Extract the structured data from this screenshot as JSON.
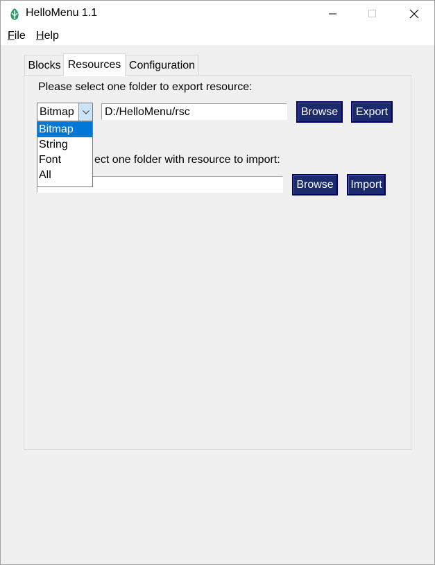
{
  "window": {
    "title": "HelloMenu 1.1",
    "icon": "app-leaf-icon",
    "controls": [
      "minimize-icon",
      "maximize-icon",
      "close-icon"
    ]
  },
  "menubar": {
    "file": {
      "accel": "F",
      "rest": "ile"
    },
    "help": {
      "accel": "H",
      "rest": "elp"
    }
  },
  "tabs": [
    {
      "label": "Blocks",
      "active": false
    },
    {
      "label": "Resources",
      "active": true
    },
    {
      "label": "Configuration",
      "active": false
    }
  ],
  "export": {
    "prompt": "Please select one folder to export resource:",
    "type_selected": "Bitmap",
    "path": "D:/HelloMenu/rsc",
    "browse_label": "Browse",
    "export_label": "Export"
  },
  "import": {
    "prompt_visible": "ect one folder with resource to import:",
    "path": "",
    "browse_label": "Browse",
    "import_label": "Import"
  },
  "dropdown": {
    "options": [
      "Bitmap",
      "String",
      "Font",
      "All"
    ],
    "selected_index": 0
  },
  "colors": {
    "button_bg": "#1a2a6c",
    "selection": "#0078d7",
    "combo_button": "#cce4f7"
  }
}
